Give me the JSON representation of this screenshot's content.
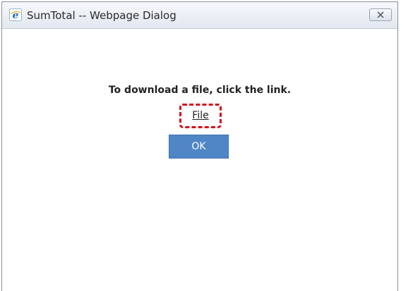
{
  "window": {
    "title": "SumTotal -- Webpage Dialog",
    "icon": "ie-logo-icon",
    "close_icon": "close-icon"
  },
  "dialog": {
    "message": "To download a file, click the link.",
    "link_label": "File",
    "ok_label": "OK"
  },
  "colors": {
    "ok_button": "#4f86c6",
    "highlight_border": "#d4111b",
    "ie_logo": "#1f6fc1"
  }
}
